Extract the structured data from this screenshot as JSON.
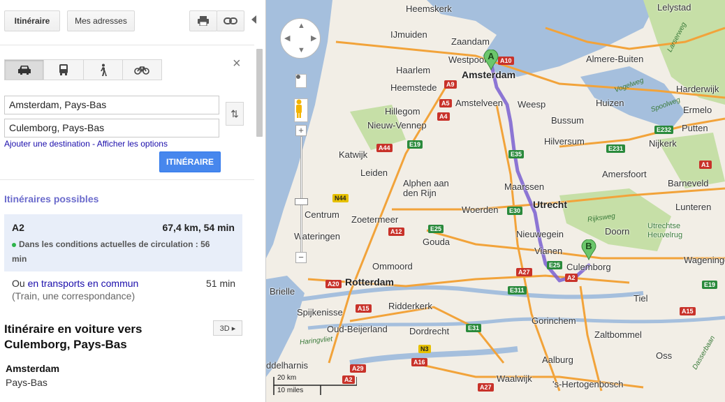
{
  "toolbar": {
    "route_label": "Itinéraire",
    "addresses_label": "Mes adresses",
    "print_icon": "print-icon",
    "link_icon": "link-icon"
  },
  "modes": [
    {
      "name": "car",
      "icon": "car-icon",
      "glyph": "🚗",
      "active": true
    },
    {
      "name": "transit",
      "icon": "bus-icon",
      "glyph": "🚌",
      "active": false
    },
    {
      "name": "walk",
      "icon": "walk-icon",
      "glyph": "🚶",
      "active": false
    },
    {
      "name": "bike",
      "icon": "bike-icon",
      "glyph": "🚲",
      "active": false
    }
  ],
  "directions": {
    "origin": "Amsterdam, Pays-Bas",
    "destination": "Culemborg, Pays-Bas",
    "add_destination": "Ajouter une destination",
    "link_separator": " - ",
    "show_options": "Afficher les options",
    "submit_label": "ITINÉRAIRE",
    "close_glyph": "×",
    "swap_glyph": "⇅"
  },
  "results": {
    "heading": "Itinéraires possibles",
    "route": {
      "name": "A2",
      "distance_time": "67,4 km, 54 min",
      "traffic": "Dans les conditions actuelles de circulation : 56 min"
    },
    "transit_prefix": "Ou ",
    "transit_link": "en transports en commun",
    "transit_time": "51 min",
    "transit_detail": "(Train, une correspondance)"
  },
  "driving": {
    "title": "Itinéraire en voiture vers Culemborg, Pays-Bas",
    "btn_3d": "3D ▸",
    "start_name": "Amsterdam",
    "start_country": "Pays-Bas"
  },
  "map": {
    "colors": {
      "water": "#a5bfdd",
      "land": "#f2eee6",
      "green": "#c6dfa7",
      "motorway": "#f2a33a",
      "route": "#7a5fd0"
    },
    "markers": {
      "a": "A",
      "b": "B"
    },
    "pan_arrows": [
      "▲",
      "◀",
      "▶",
      "▼"
    ],
    "zoom_in": "+",
    "zoom_out": "−",
    "scale_km": "20 km",
    "scale_miles": "10 miles",
    "places": [
      {
        "id": "heemskerk",
        "name": "Heemskerk",
        "kind": "city"
      },
      {
        "id": "zaandam",
        "name": "Zaandam",
        "kind": "city"
      },
      {
        "id": "ijmuiden",
        "name": "IJmuiden",
        "kind": "city"
      },
      {
        "id": "westpoort",
        "name": "Westpoort",
        "kind": "city"
      },
      {
        "id": "amsterdam",
        "name": "Amsterdam",
        "kind": "big"
      },
      {
        "id": "lelystad",
        "name": "Lelystad",
        "kind": "city"
      },
      {
        "id": "almere",
        "name": "Almere-Buiten",
        "kind": "city"
      },
      {
        "id": "haarlem",
        "name": "Haarlem",
        "kind": "city"
      },
      {
        "id": "heemstede",
        "name": "Heemstede",
        "kind": "city"
      },
      {
        "id": "amstelveen",
        "name": "Amstelveen",
        "kind": "city"
      },
      {
        "id": "weesp",
        "name": "Weesp",
        "kind": "city"
      },
      {
        "id": "huizen",
        "name": "Huizen",
        "kind": "city"
      },
      {
        "id": "harderwijk",
        "name": "Harderwijk",
        "kind": "city"
      },
      {
        "id": "hillegom",
        "name": "Hillegom",
        "kind": "city"
      },
      {
        "id": "bussum",
        "name": "Bussum",
        "kind": "city"
      },
      {
        "id": "ermelo",
        "name": "Ermelo",
        "kind": "city"
      },
      {
        "id": "nieuw_vennep",
        "name": "Nieuw-Vennep",
        "kind": "city"
      },
      {
        "id": "putten",
        "name": "Putten",
        "kind": "city"
      },
      {
        "id": "hilversum",
        "name": "Hilversum",
        "kind": "city"
      },
      {
        "id": "nijkerk",
        "name": "Nijkerk",
        "kind": "city"
      },
      {
        "id": "katwijk",
        "name": "Katwijk",
        "kind": "city"
      },
      {
        "id": "leiden",
        "name": "Leiden",
        "kind": "city"
      },
      {
        "id": "amersfoort",
        "name": "Amersfoort",
        "kind": "city"
      },
      {
        "id": "alphen",
        "name": "Alphen aan\nden Rijn",
        "kind": "city"
      },
      {
        "id": "maarssen",
        "name": "Maarssen",
        "kind": "city"
      },
      {
        "id": "barneveld",
        "name": "Barneveld",
        "kind": "city"
      },
      {
        "id": "utrecht",
        "name": "Utrecht",
        "kind": "big"
      },
      {
        "id": "centrum",
        "name": "Centrum",
        "kind": "city"
      },
      {
        "id": "woerden",
        "name": "Woerden",
        "kind": "city"
      },
      {
        "id": "lunteren",
        "name": "Lunteren",
        "kind": "city"
      },
      {
        "id": "zoetermeer",
        "name": "Zoetermeer",
        "kind": "city"
      },
      {
        "id": "doorn",
        "name": "Doorn",
        "kind": "city"
      },
      {
        "id": "heuvelrug",
        "name": "Utrechtse\nHeuvelrug",
        "kind": "park"
      },
      {
        "id": "nieuwegein",
        "name": "Nieuwegein",
        "kind": "city"
      },
      {
        "id": "gouda",
        "name": "Gouda",
        "kind": "city"
      },
      {
        "id": "wateringen",
        "name": "Wateringen",
        "kind": "city"
      },
      {
        "id": "vianen",
        "name": "Vianen",
        "kind": "city"
      },
      {
        "id": "culemborg",
        "name": "Culemborg",
        "kind": "city"
      },
      {
        "id": "wageningen",
        "name": "Wageninge",
        "kind": "city"
      },
      {
        "id": "ommoord",
        "name": "Ommoord",
        "kind": "city"
      },
      {
        "id": "rotterdam",
        "name": "Rotterdam",
        "kind": "big"
      },
      {
        "id": "brielle",
        "name": "Brielle",
        "kind": "city"
      },
      {
        "id": "tiel",
        "name": "Tiel",
        "kind": "city"
      },
      {
        "id": "spijkenisse",
        "name": "Spijkenisse",
        "kind": "city"
      },
      {
        "id": "ridderkerk",
        "name": "Ridderkerk",
        "kind": "city"
      },
      {
        "id": "gorinchem",
        "name": "Gorinchem",
        "kind": "city"
      },
      {
        "id": "oud_beijerland",
        "name": "Oud-Beijerland",
        "kind": "city"
      },
      {
        "id": "dordrecht",
        "name": "Dordrecht",
        "kind": "city"
      },
      {
        "id": "zaltbommel",
        "name": "Zaltbommel",
        "kind": "city"
      },
      {
        "id": "oss",
        "name": "Oss",
        "kind": "city"
      },
      {
        "id": "aalburg",
        "name": "Aalburg",
        "kind": "city"
      },
      {
        "id": "middelharnis",
        "name": "ddelharnis",
        "kind": "city"
      },
      {
        "id": "waalwijk",
        "name": "Waalwijk",
        "kind": "city"
      },
      {
        "id": "hertogenbosch",
        "name": "'s-Hertogenbosch",
        "kind": "city"
      }
    ],
    "road_names": [
      {
        "id": "larserweg",
        "name": "Larserweg"
      },
      {
        "id": "vogelweg",
        "name": "Vogelweg"
      },
      {
        "id": "spoolweg",
        "name": "Spoolweg"
      },
      {
        "id": "rijksweg",
        "name": "Rijksweg"
      },
      {
        "id": "haringvliet",
        "name": "Haringvliet"
      },
      {
        "id": "dasserbaan",
        "name": "Dasserbaan"
      }
    ],
    "shields": [
      {
        "id": "a10",
        "label": "A10",
        "type": "a"
      },
      {
        "id": "a9",
        "label": "A9",
        "type": "a"
      },
      {
        "id": "a5",
        "label": "A5",
        "type": "a"
      },
      {
        "id": "a4",
        "label": "A4",
        "type": "a"
      },
      {
        "id": "e19",
        "label": "E19",
        "type": "e"
      },
      {
        "id": "a44",
        "label": "A44",
        "type": "a"
      },
      {
        "id": "e35",
        "label": "E35",
        "type": "e"
      },
      {
        "id": "a12",
        "label": "A12",
        "type": "a"
      },
      {
        "id": "e25",
        "label": "E25",
        "type": "e"
      },
      {
        "id": "e30",
        "label": "E30",
        "type": "e"
      },
      {
        "id": "a2",
        "label": "A2",
        "type": "a"
      },
      {
        "id": "a27",
        "label": "A27",
        "type": "a"
      },
      {
        "id": "e25b",
        "label": "E25",
        "type": "e"
      },
      {
        "id": "a20",
        "label": "A20",
        "type": "a"
      },
      {
        "id": "a15",
        "label": "A15",
        "type": "a"
      },
      {
        "id": "e311",
        "label": "E311",
        "type": "e"
      },
      {
        "id": "e31",
        "label": "E31",
        "type": "e"
      },
      {
        "id": "a16",
        "label": "A16",
        "type": "a"
      },
      {
        "id": "n3",
        "label": "N3",
        "type": "n"
      },
      {
        "id": "a29",
        "label": "A29",
        "type": "a"
      },
      {
        "id": "e231",
        "label": "E231",
        "type": "e"
      },
      {
        "id": "e232",
        "label": "E232",
        "type": "e"
      },
      {
        "id": "a1",
        "label": "A1",
        "type": "a"
      },
      {
        "id": "n44",
        "label": "N44",
        "type": "n"
      },
      {
        "id": "a27b",
        "label": "A27",
        "type": "a"
      },
      {
        "id": "a2b",
        "label": "A2",
        "type": "a"
      },
      {
        "id": "a15b",
        "label": "A15",
        "type": "a"
      },
      {
        "id": "e19b",
        "label": "E19",
        "type": "e"
      }
    ]
  }
}
